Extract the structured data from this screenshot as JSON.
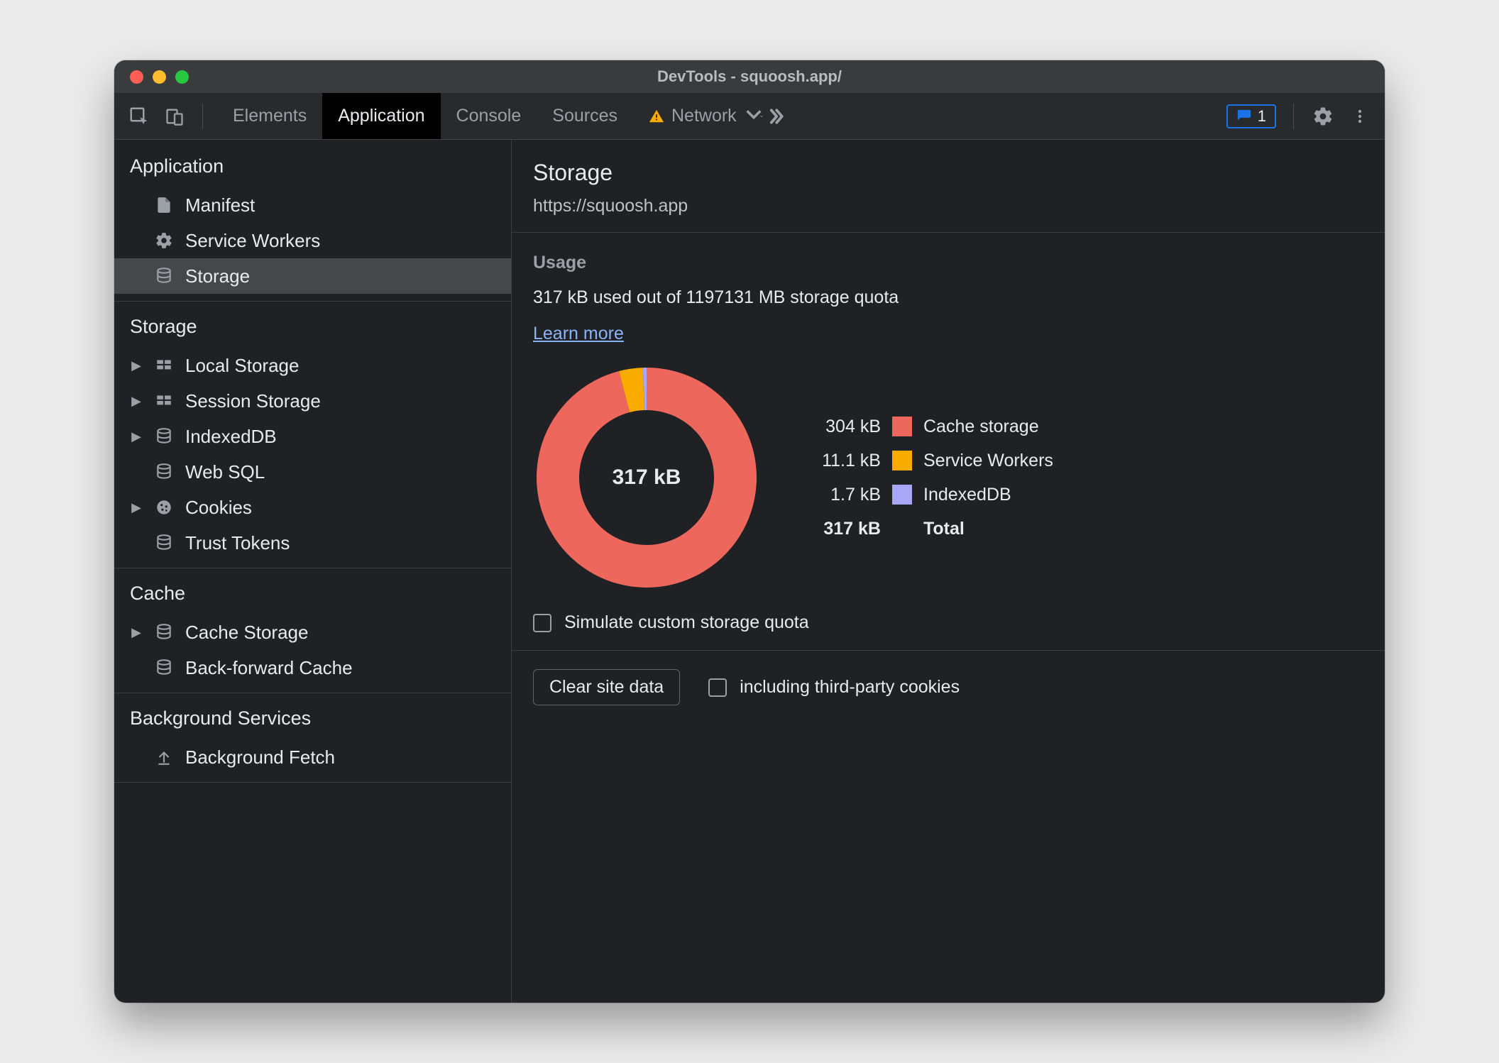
{
  "window": {
    "title": "DevTools - squoosh.app/"
  },
  "toolbar": {
    "tabs": [
      "Elements",
      "Application",
      "Console",
      "Sources",
      "Network"
    ],
    "active_tab_index": 1,
    "network_warning": true,
    "messages_count": "1"
  },
  "sidebar": {
    "groups": [
      {
        "title": "Application",
        "items": [
          {
            "label": "Manifest",
            "icon": "file",
            "expandable": false
          },
          {
            "label": "Service Workers",
            "icon": "gear",
            "expandable": false
          },
          {
            "label": "Storage",
            "icon": "db",
            "expandable": false,
            "selected": true
          }
        ]
      },
      {
        "title": "Storage",
        "items": [
          {
            "label": "Local Storage",
            "icon": "grid",
            "expandable": true
          },
          {
            "label": "Session Storage",
            "icon": "grid",
            "expandable": true
          },
          {
            "label": "IndexedDB",
            "icon": "db",
            "expandable": true
          },
          {
            "label": "Web SQL",
            "icon": "db",
            "expandable": false
          },
          {
            "label": "Cookies",
            "icon": "cookie",
            "expandable": true
          },
          {
            "label": "Trust Tokens",
            "icon": "db",
            "expandable": false
          }
        ]
      },
      {
        "title": "Cache",
        "items": [
          {
            "label": "Cache Storage",
            "icon": "db",
            "expandable": true
          },
          {
            "label": "Back-forward Cache",
            "icon": "db",
            "expandable": false
          }
        ]
      },
      {
        "title": "Background Services",
        "items": [
          {
            "label": "Background Fetch",
            "icon": "upload",
            "expandable": false
          }
        ]
      }
    ]
  },
  "content": {
    "heading": "Storage",
    "origin": "https://squoosh.app",
    "usage": {
      "title": "Usage",
      "summary": "317 kB used out of 1197131 MB storage quota",
      "learn_more": "Learn more",
      "total_label": "317 kB",
      "simulate_label": "Simulate custom storage quota"
    },
    "clear": {
      "button": "Clear site data",
      "checkbox_label": "including third-party cookies"
    },
    "legend_total_label": "Total"
  },
  "chart_data": {
    "type": "pie",
    "title": "Storage usage breakdown",
    "total": {
      "amount": "317 kB"
    },
    "series": [
      {
        "name": "Cache storage",
        "amount": "304 kB",
        "value": 304000,
        "color": "#ee675c"
      },
      {
        "name": "Service Workers",
        "amount": "11.1 kB",
        "value": 11100,
        "color": "#f9ab00"
      },
      {
        "name": "IndexedDB",
        "amount": "1.7 kB",
        "value": 1700,
        "color": "#a7a6f7"
      }
    ]
  }
}
